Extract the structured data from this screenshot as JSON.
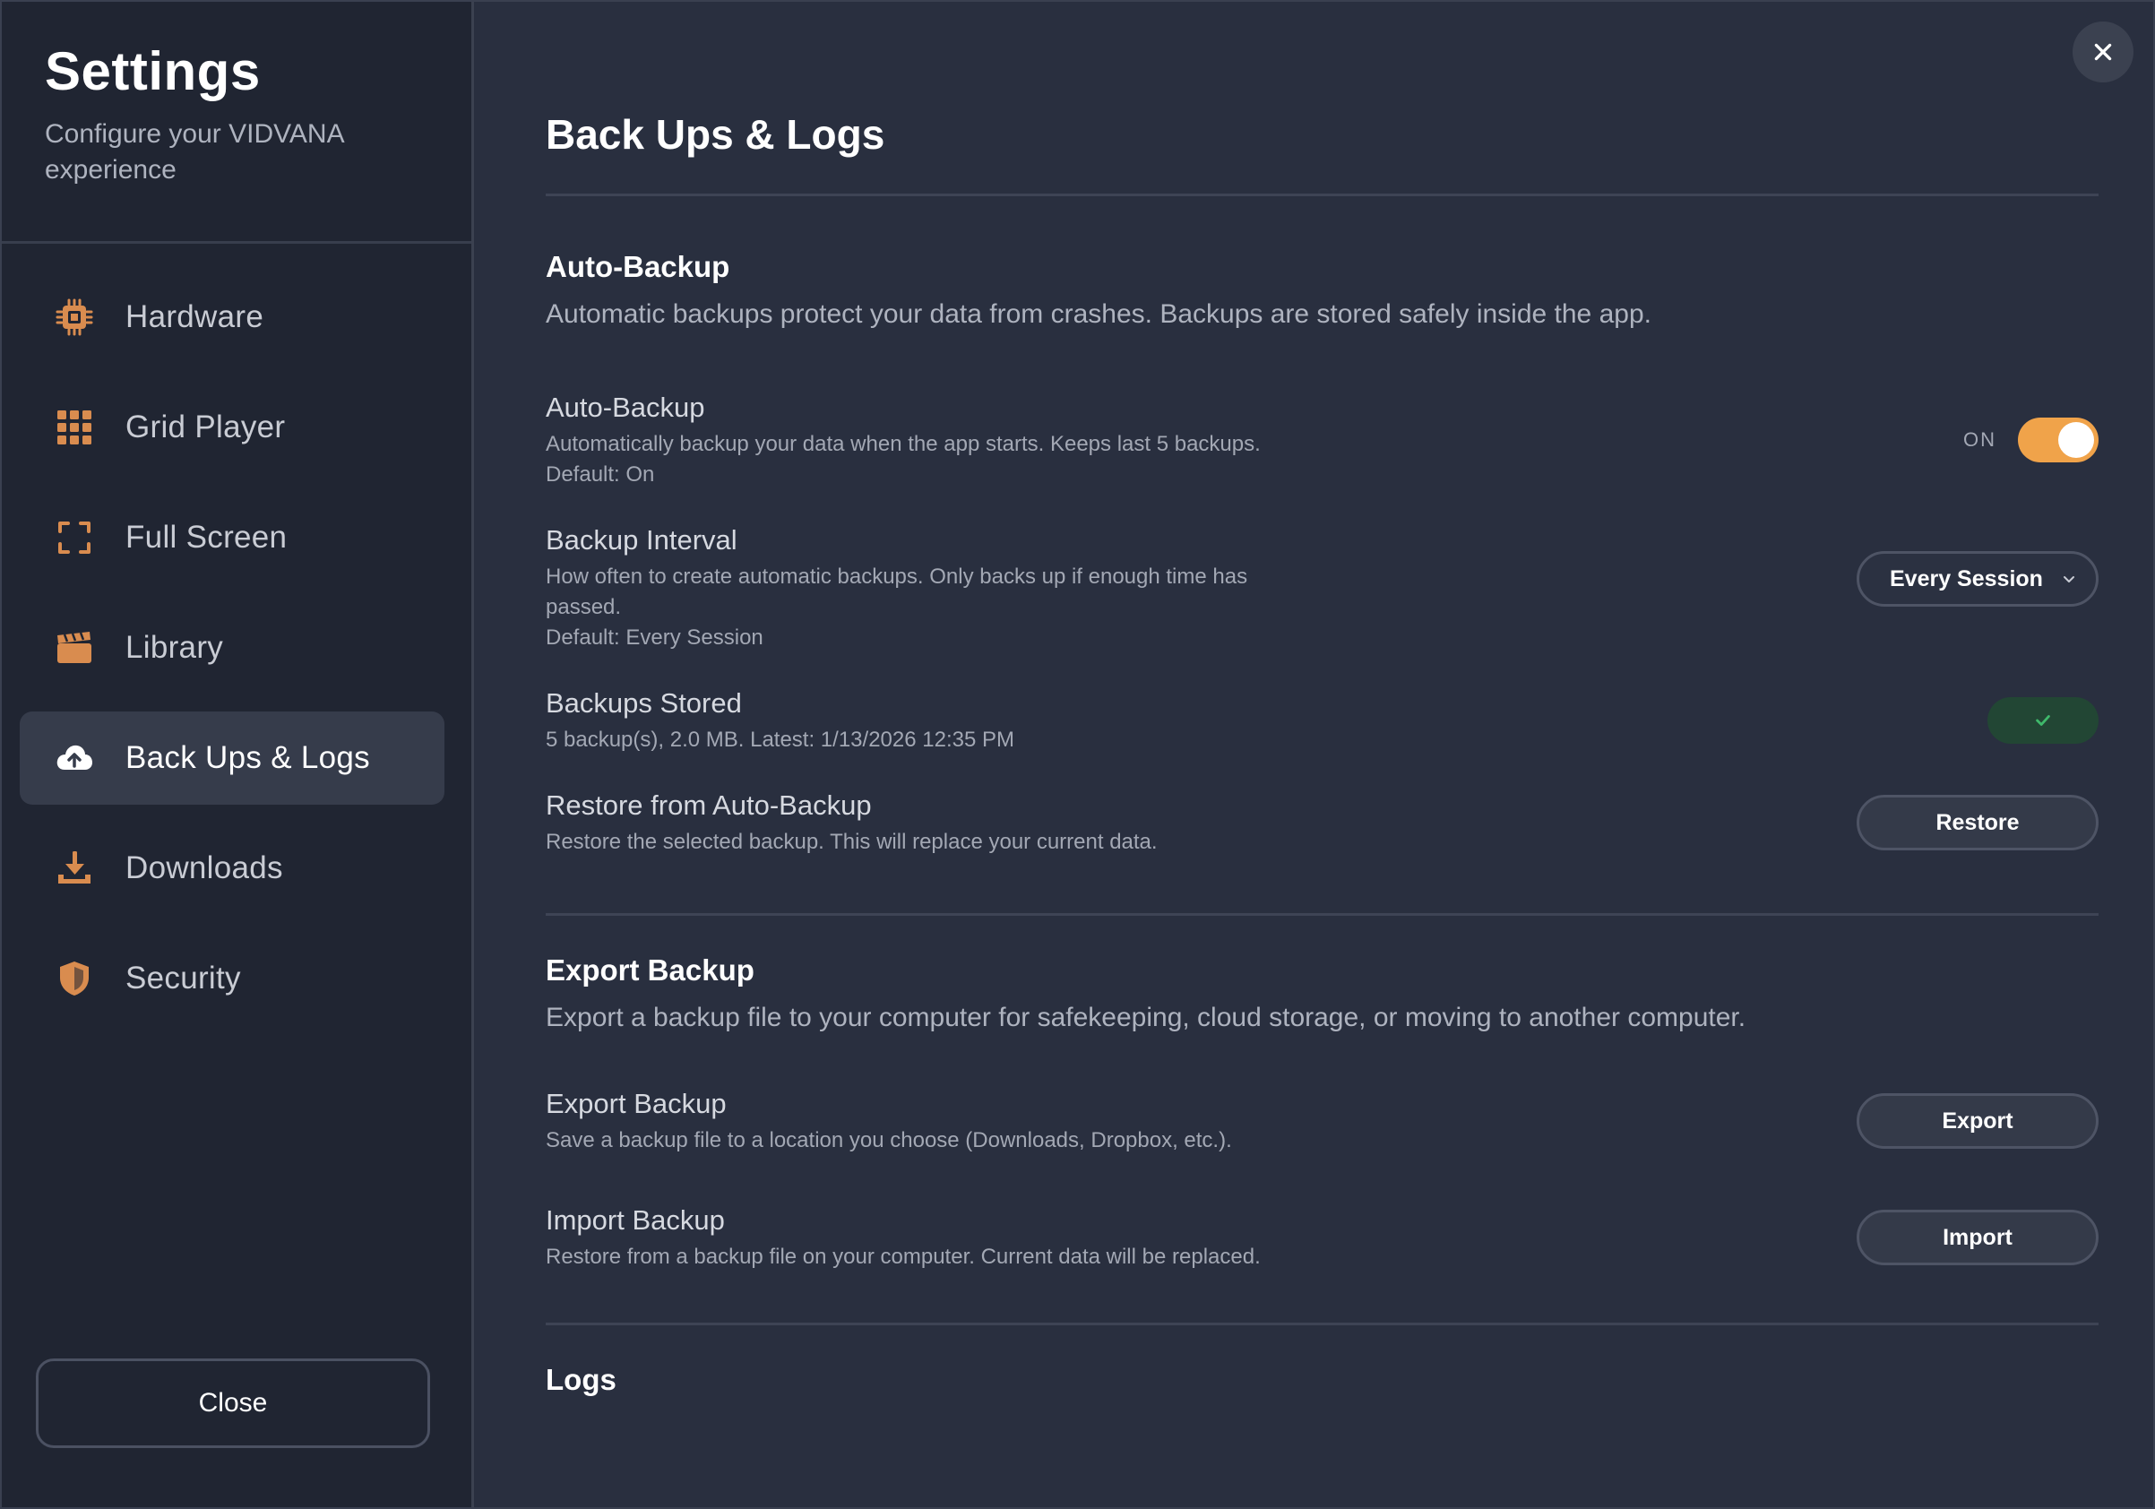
{
  "sidebar": {
    "title": "Settings",
    "subtitle": "Configure your VIDVANA experience",
    "items": [
      {
        "label": "Hardware",
        "icon": "chip-icon"
      },
      {
        "label": "Grid Player",
        "icon": "grid-icon"
      },
      {
        "label": "Full Screen",
        "icon": "fullscreen-icon"
      },
      {
        "label": "Library",
        "icon": "clapperboard-icon"
      },
      {
        "label": "Back Ups & Logs",
        "icon": "cloud-upload-icon",
        "active": true
      },
      {
        "label": "Downloads",
        "icon": "download-icon"
      },
      {
        "label": "Security",
        "icon": "shield-icon"
      }
    ],
    "close_label": "Close"
  },
  "main": {
    "page_title": "Back Ups & Logs",
    "auto_backup_section": {
      "title": "Auto-Backup",
      "description": "Automatic backups protect your data from crashes. Backups are stored safely inside the app."
    },
    "auto_backup": {
      "title": "Auto-Backup",
      "description": "Automatically backup your data when the app starts. Keeps last 5 backups.",
      "default": "Default: On",
      "toggle_label": "ON",
      "enabled": true
    },
    "backup_interval": {
      "title": "Backup Interval",
      "description": "How often to create automatic backups. Only backs up if enough time has passed.",
      "default": "Default: Every Session",
      "selected": "Every Session"
    },
    "backups_stored": {
      "title": "Backups Stored",
      "description": "5 backup(s), 2.0 MB. Latest: 1/13/2026 12:35 PM",
      "status": "ok"
    },
    "restore": {
      "title": "Restore from Auto-Backup",
      "description": "Restore the selected backup. This will replace your current data.",
      "button_label": "Restore"
    },
    "export_section": {
      "title": "Export Backup",
      "description": "Export a backup file to your computer for safekeeping, cloud storage, or moving to another computer."
    },
    "export": {
      "title": "Export Backup",
      "description": "Save a backup file to a location you choose (Downloads, Dropbox, etc.).",
      "button_label": "Export"
    },
    "import": {
      "title": "Import Backup",
      "description": "Restore from a backup file on your computer. Current data will be replaced.",
      "button_label": "Import"
    },
    "logs_section": {
      "title": "Logs"
    }
  },
  "colors": {
    "accent": "#f0a34a",
    "icon": "#d98c4f",
    "background": "#292f3f",
    "sidebar": "#202532",
    "success": "#3fb96b"
  }
}
